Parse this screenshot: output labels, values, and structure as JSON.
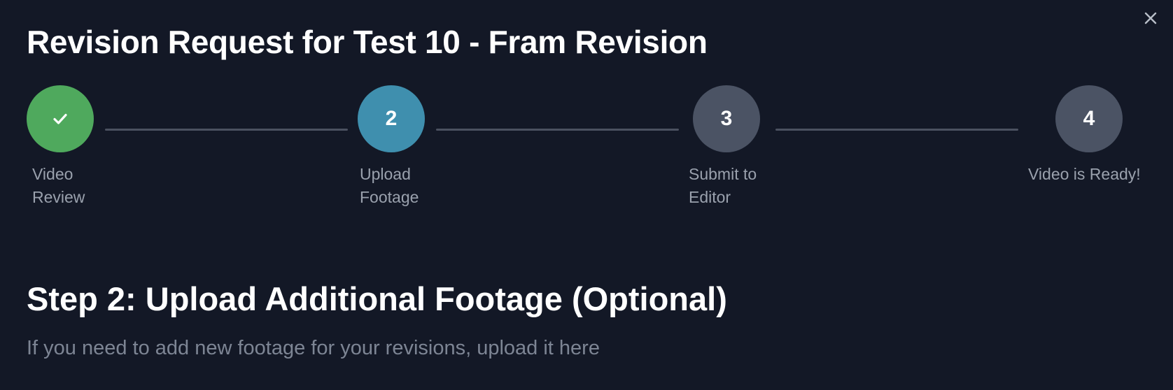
{
  "modal": {
    "title": "Revision Request for Test 10 - Fram Revision",
    "close_icon": "close-icon"
  },
  "stepper": {
    "steps": [
      {
        "number": "",
        "icon": "checkmark-icon",
        "label_line1": "Video",
        "label_line2": "Review",
        "status": "completed"
      },
      {
        "number": "2",
        "label_line1": "Upload",
        "label_line2": "Footage",
        "status": "active"
      },
      {
        "number": "3",
        "label_line1": "Submit to",
        "label_line2": "Editor",
        "status": "pending"
      },
      {
        "number": "4",
        "label_line1": "Video is Ready!",
        "label_line2": "",
        "status": "pending"
      }
    ]
  },
  "section": {
    "heading": "Step 2: Upload Additional Footage (Optional)",
    "description": "If you need to add new footage for your revisions, upload it here"
  },
  "colors": {
    "background": "#131826",
    "completed": "#4fa95d",
    "active": "#3f8fae",
    "pending": "#4b5364",
    "connector": "#4b5160",
    "label": "#9aa1ad",
    "muted_text": "#7d8594"
  }
}
